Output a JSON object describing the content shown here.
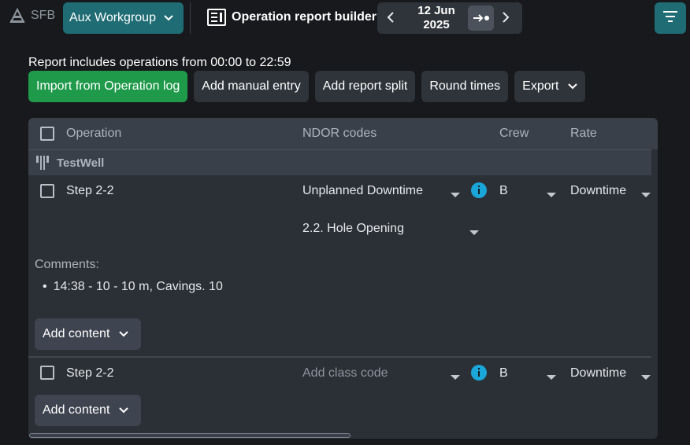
{
  "header": {
    "brand": "SFB",
    "workgroup_label": "Aux Workgroup",
    "title": "Operation report builder",
    "date_line1": "12 Jun",
    "date_line2": "2025"
  },
  "range_text": "Report includes operations from 00:00 to 22:59",
  "actions": {
    "import_label": "Import from Operation log",
    "manual_label": "Add manual entry",
    "split_label": "Add report split",
    "round_label": "Round times",
    "export_label": "Export"
  },
  "table": {
    "columns": {
      "operation": "Operation",
      "ndor": "NDOR codes",
      "crew": "Crew",
      "rate": "Rate"
    },
    "group": {
      "name": "TestWell"
    },
    "rows": [
      {
        "operation": "Step 2-2",
        "ndor_code": "Unplanned Downtime",
        "ndor_subcode": "2.2. Hole Opening",
        "crew": "B",
        "rate": "Downtime",
        "comments_label": "Comments:",
        "comments": [
          "14:38 - 10 - 10 m, Cavings. 10"
        ],
        "add_content_label": "Add content"
      },
      {
        "operation": "Step 2-2",
        "ndor_placeholder": "Add class code",
        "crew": "B",
        "rate": "Downtime",
        "add_content_label": "Add content"
      }
    ]
  },
  "colors": {
    "background": "#17191c",
    "teal_accent": "#1f6c74",
    "primary_green": "#1f9a4a",
    "info_blue": "#1ba6d9"
  },
  "icons": {
    "brand": "rig-icon",
    "workgroup": "chevron-down-icon",
    "report": "report-icon",
    "prev": "chevron-left-icon",
    "today": "go-to-today-icon",
    "next": "chevron-right-icon",
    "filter": "filter-icon",
    "group": "well-icon",
    "info": "info-icon"
  }
}
